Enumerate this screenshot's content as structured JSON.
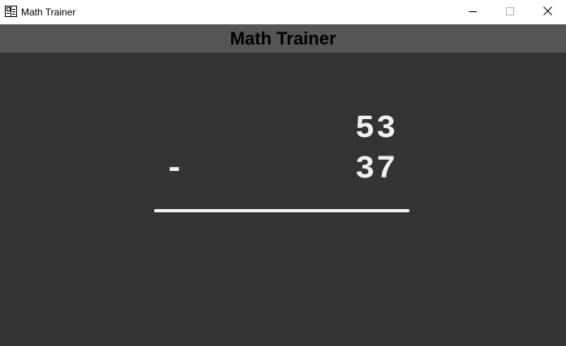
{
  "window": {
    "title": "Math Trainer",
    "icon": "calculator-app-icon",
    "controls": {
      "minimize_icon": "minimize-icon",
      "maximize_icon": "maximize-icon",
      "close_icon": "close-icon"
    }
  },
  "header": {
    "title": "Math Trainer"
  },
  "problem": {
    "top_operand": "53",
    "bottom_operand": "37",
    "operator": "-"
  },
  "colors": {
    "background": "#333333",
    "header_bar": "#555555",
    "text": "#f0f0f0"
  }
}
